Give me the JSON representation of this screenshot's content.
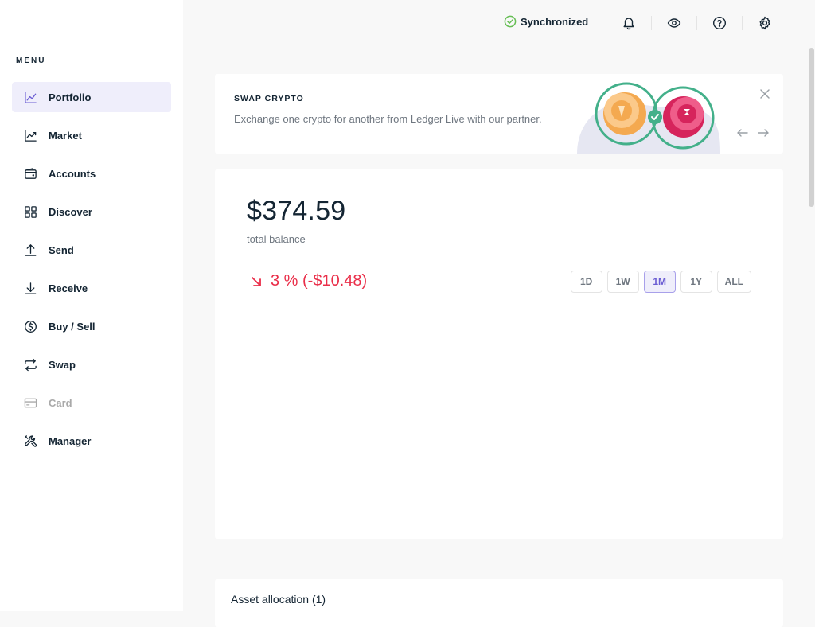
{
  "sidebar": {
    "menu_title": "MENU",
    "items": [
      {
        "label": "Portfolio",
        "icon": "chart-line-icon",
        "active": true
      },
      {
        "label": "Market",
        "icon": "trending-chart-icon"
      },
      {
        "label": "Accounts",
        "icon": "wallet-icon"
      },
      {
        "label": "Discover",
        "icon": "grid-icon"
      },
      {
        "label": "Send",
        "icon": "arrow-up-icon"
      },
      {
        "label": "Receive",
        "icon": "arrow-down-icon"
      },
      {
        "label": "Buy / Sell",
        "icon": "dollar-circle-icon"
      },
      {
        "label": "Swap",
        "icon": "swap-arrows-icon"
      },
      {
        "label": "Card",
        "icon": "credit-card-icon",
        "disabled": true
      },
      {
        "label": "Manager",
        "icon": "tools-icon"
      }
    ]
  },
  "topbar": {
    "sync_label": "Synchronized",
    "sync_color": "#66be54",
    "icons": [
      "bell-icon",
      "eye-icon",
      "help-icon",
      "gear-icon"
    ]
  },
  "banner": {
    "title": "SWAP CRYPTO",
    "description": "Exchange one crypto for another from Ledger Live with our partner."
  },
  "portfolio": {
    "balance": "$374.59",
    "balance_label": "total balance",
    "change": "3 % (-$10.48)",
    "change_color": "#ea2e49",
    "ranges": [
      "1D",
      "1W",
      "1M",
      "1Y",
      "ALL"
    ],
    "selected_range": "1M"
  },
  "allocation": {
    "title": "Asset allocation (1)"
  },
  "colors": {
    "accent": "#6b5dd3",
    "accent_bg": "#efeefb"
  }
}
